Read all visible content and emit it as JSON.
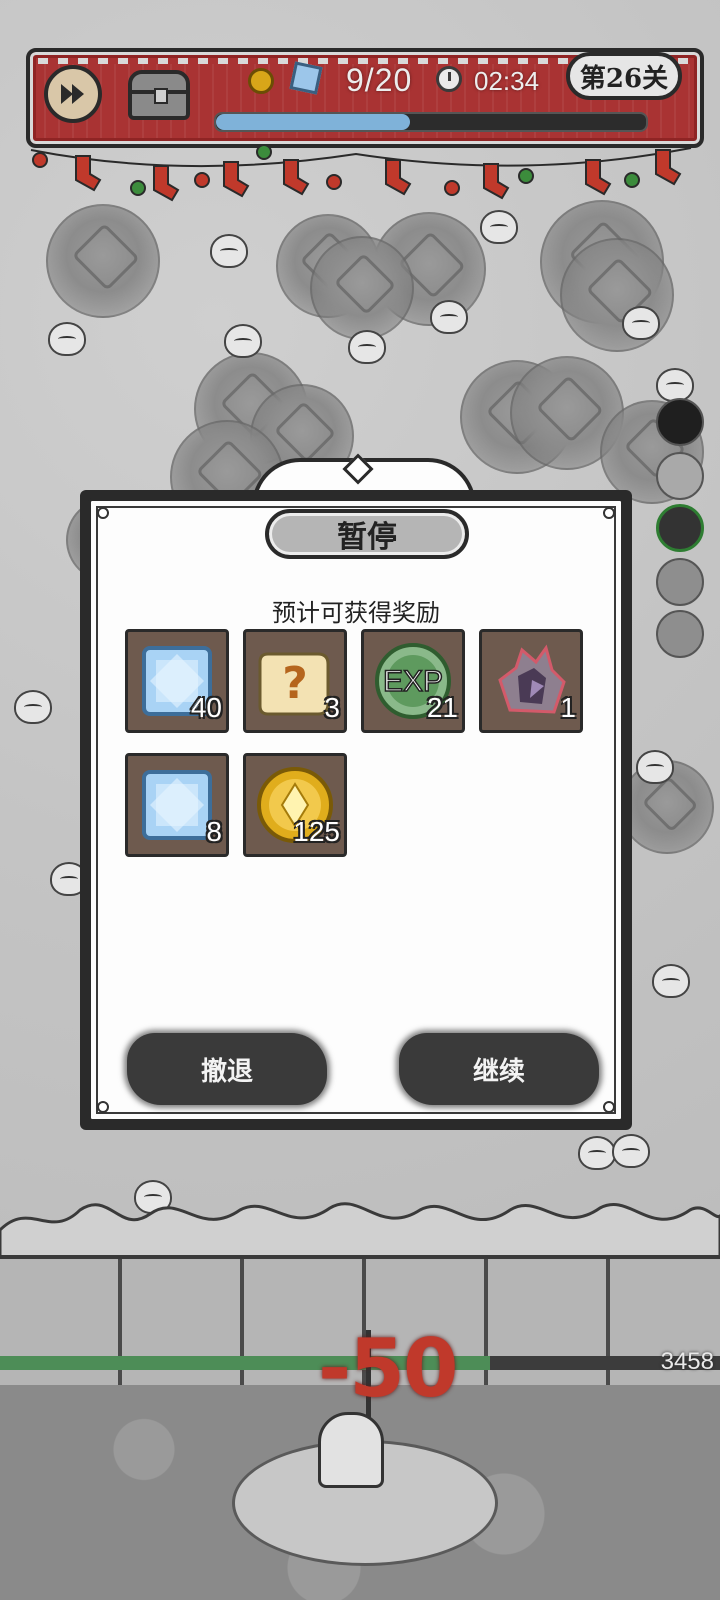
{
  "hud": {
    "fast_forward_icon": "fast-forward-icon",
    "chest_icon": "treasure-chest-icon",
    "wave_progress": "9/20",
    "wave_fraction": 0.45,
    "timer": "02:34",
    "level": "第26关"
  },
  "dialog": {
    "title": "暂停",
    "subtitle": "预计可获得奖励",
    "rewards": [
      {
        "icon": "blue-gem-icon",
        "count": "40"
      },
      {
        "icon": "mystery-scroll-icon",
        "count": "3"
      },
      {
        "icon": "exp-medal-icon",
        "label": "EXP",
        "count": "21"
      },
      {
        "icon": "dark-crystal-icon",
        "count": "1"
      },
      {
        "icon": "blue-gem-icon",
        "count": "8"
      },
      {
        "icon": "gold-coin-icon",
        "count": "125"
      }
    ],
    "retreat_button": "撤退",
    "continue_button": "继续"
  },
  "battle": {
    "damage_text": "-50",
    "wall_hp": "3458",
    "hp_fraction": 0.68
  },
  "colors": {
    "hud_red": "#a93333",
    "damage_red": "#c0392b",
    "hp_green": "#4d8d57",
    "reward_tile": "#6e5a4e"
  }
}
